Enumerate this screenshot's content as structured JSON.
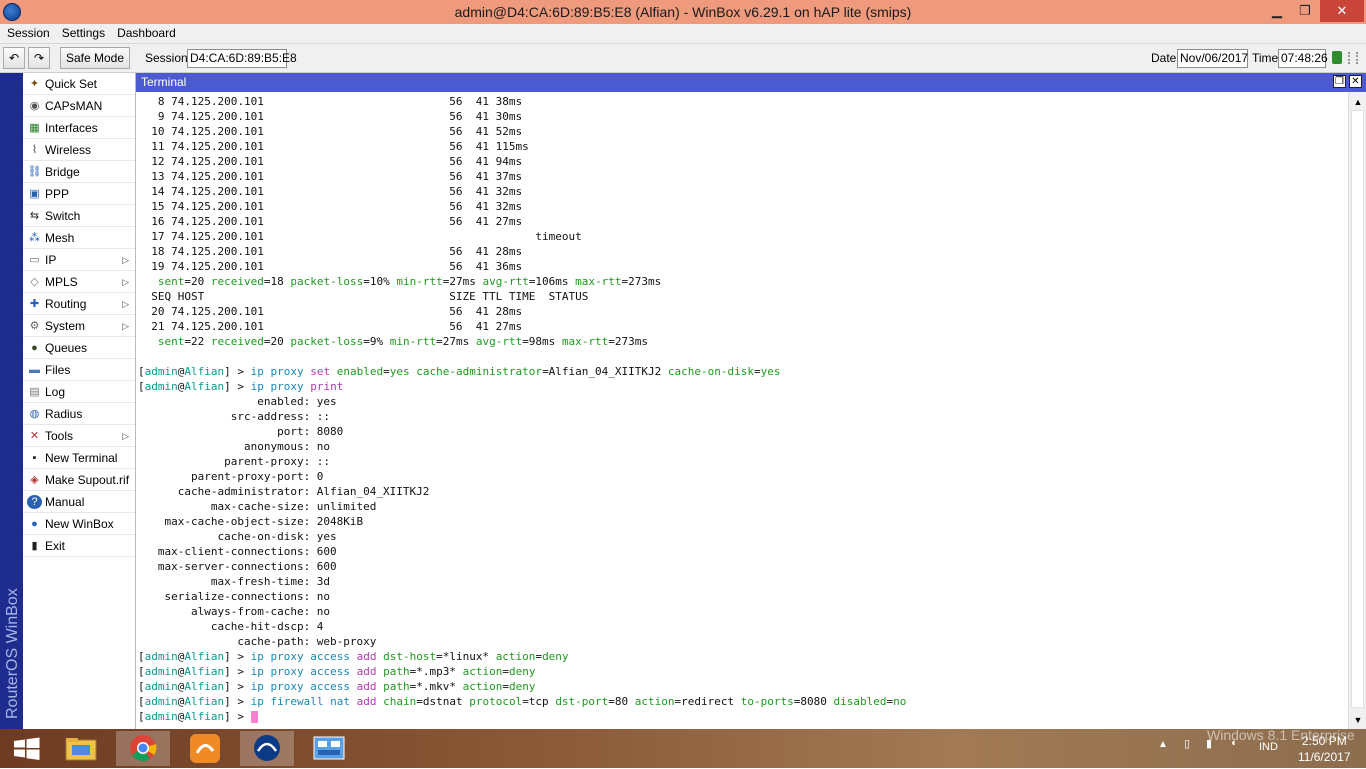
{
  "window": {
    "title": "admin@D4:CA:6D:89:B5:E8 (Alfian) - WinBox v6.29.1 on hAP lite (smips)"
  },
  "menu": [
    "Session",
    "Settings",
    "Dashboard"
  ],
  "toolbar": {
    "safe_mode_label": "Safe Mode",
    "session_label": "Session:",
    "session_value": "D4:CA:6D:89:B5:E8",
    "date_label": "Date:",
    "date_value": "Nov/06/2017",
    "time_label": "Time:",
    "time_value": "07:48:26"
  },
  "brand": "RouterOS WinBox",
  "sidebar": [
    {
      "label": "Quick Set",
      "icon": "quickset-icon",
      "glyph": "✦",
      "color": "#7a4a1a"
    },
    {
      "label": "CAPsMAN",
      "icon": "capsman-icon",
      "glyph": "◉",
      "color": "#555"
    },
    {
      "label": "Interfaces",
      "icon": "interfaces-icon",
      "glyph": "▦",
      "color": "#1f7a1f"
    },
    {
      "label": "Wireless",
      "icon": "wireless-icon",
      "glyph": "⌇",
      "color": "#444"
    },
    {
      "label": "Bridge",
      "icon": "bridge-icon",
      "glyph": "⛓",
      "color": "#2a62b3"
    },
    {
      "label": "PPP",
      "icon": "ppp-icon",
      "glyph": "▣",
      "color": "#2a62b3"
    },
    {
      "label": "Switch",
      "icon": "switch-icon",
      "glyph": "⇆",
      "color": "#333"
    },
    {
      "label": "Mesh",
      "icon": "mesh-icon",
      "glyph": "⁂",
      "color": "#2a62b3"
    },
    {
      "label": "IP",
      "icon": "ip-icon",
      "glyph": "▭",
      "color": "#666",
      "arrow": true
    },
    {
      "label": "MPLS",
      "icon": "mpls-icon",
      "glyph": "◇",
      "color": "#777",
      "arrow": true
    },
    {
      "label": "Routing",
      "icon": "routing-icon",
      "glyph": "✚",
      "color": "#2a62b3",
      "arrow": true
    },
    {
      "label": "System",
      "icon": "system-icon",
      "glyph": "⚙",
      "color": "#666",
      "arrow": true
    },
    {
      "label": "Queues",
      "icon": "queues-icon",
      "glyph": "●",
      "color": "#3a4a2a"
    },
    {
      "label": "Files",
      "icon": "files-icon",
      "glyph": "▬",
      "color": "#4a7ab8"
    },
    {
      "label": "Log",
      "icon": "log-icon",
      "glyph": "▤",
      "color": "#777"
    },
    {
      "label": "Radius",
      "icon": "radius-icon",
      "glyph": "◍",
      "color": "#2a62b3"
    },
    {
      "label": "Tools",
      "icon": "tools-icon",
      "glyph": "✕",
      "color": "#a33",
      "arrow": true
    },
    {
      "label": "New Terminal",
      "icon": "terminal-icon",
      "glyph": "▪",
      "color": "#222"
    },
    {
      "label": "Make Supout.rif",
      "icon": "supout-icon",
      "glyph": "◈",
      "color": "#a33"
    },
    {
      "label": "Manual",
      "icon": "manual-icon",
      "glyph": "?",
      "color": "#fff",
      "bg": "#2a62b3"
    },
    {
      "label": "New WinBox",
      "icon": "winbox-icon",
      "glyph": "●",
      "color": "#2a62b3"
    },
    {
      "label": "Exit",
      "icon": "exit-icon",
      "glyph": "▮",
      "color": "#222"
    }
  ],
  "terminal_title": "Terminal",
  "terminal_lines": [
    [
      [
        "   8 74.125.200.101                            56  41 38ms",
        "k"
      ]
    ],
    [
      [
        "   9 74.125.200.101                            56  41 30ms",
        "k"
      ]
    ],
    [
      [
        "  10 74.125.200.101                            56  41 52ms",
        "k"
      ]
    ],
    [
      [
        "  11 74.125.200.101                            56  41 115ms",
        "k"
      ]
    ],
    [
      [
        "  12 74.125.200.101                            56  41 94ms",
        "k"
      ]
    ],
    [
      [
        "  13 74.125.200.101                            56  41 37ms",
        "k"
      ]
    ],
    [
      [
        "  14 74.125.200.101                            56  41 32ms",
        "k"
      ]
    ],
    [
      [
        "  15 74.125.200.101                            56  41 32ms",
        "k"
      ]
    ],
    [
      [
        "  16 74.125.200.101                            56  41 27ms",
        "k"
      ]
    ],
    [
      [
        "  17 74.125.200.101                                         timeout",
        "k"
      ]
    ],
    [
      [
        "  18 74.125.200.101                            56  41 28ms",
        "k"
      ]
    ],
    [
      [
        "  19 74.125.200.101                            56  41 36ms",
        "k"
      ]
    ],
    [
      [
        "   ",
        "k"
      ],
      [
        "sent",
        "gr"
      ],
      [
        "=20 ",
        "k"
      ],
      [
        "received",
        "gr"
      ],
      [
        "=18 ",
        "k"
      ],
      [
        "packet-loss",
        "gr"
      ],
      [
        "=10% ",
        "k"
      ],
      [
        "min-rtt",
        "gr"
      ],
      [
        "=27ms ",
        "k"
      ],
      [
        "avg-rtt",
        "gr"
      ],
      [
        "=106ms ",
        "k"
      ],
      [
        "max-rtt",
        "gr"
      ],
      [
        "=273ms",
        "k"
      ]
    ],
    [
      [
        "  SEQ HOST                                     SIZE TTL TIME  STATUS",
        "k"
      ]
    ],
    [
      [
        "  20 74.125.200.101                            56  41 28ms",
        "k"
      ]
    ],
    [
      [
        "  21 74.125.200.101                            56  41 27ms",
        "k"
      ]
    ],
    [
      [
        "   ",
        "k"
      ],
      [
        "sent",
        "gr"
      ],
      [
        "=22 ",
        "k"
      ],
      [
        "received",
        "gr"
      ],
      [
        "=20 ",
        "k"
      ],
      [
        "packet-loss",
        "gr"
      ],
      [
        "=9% ",
        "k"
      ],
      [
        "min-rtt",
        "gr"
      ],
      [
        "=27ms ",
        "k"
      ],
      [
        "avg-rtt",
        "gr"
      ],
      [
        "=98ms ",
        "k"
      ],
      [
        "max-rtt",
        "gr"
      ],
      [
        "=273ms",
        "k"
      ]
    ],
    [
      [
        "",
        "k"
      ]
    ],
    [
      [
        "[",
        "k"
      ],
      [
        "admin",
        "g"
      ],
      [
        "@",
        "k"
      ],
      [
        "Alfian",
        "g"
      ],
      [
        "] > ",
        "k"
      ],
      [
        "ip proxy ",
        "c"
      ],
      [
        "set ",
        "p"
      ],
      [
        "enabled",
        "gr"
      ],
      [
        "=",
        "k"
      ],
      [
        "yes ",
        "gr"
      ],
      [
        "cache-administrator",
        "gr"
      ],
      [
        "=Alfian_04_XIITKJ2 ",
        "k"
      ],
      [
        "cache-on-disk",
        "gr"
      ],
      [
        "=",
        "k"
      ],
      [
        "yes",
        "gr"
      ]
    ],
    [
      [
        "[",
        "k"
      ],
      [
        "admin",
        "g"
      ],
      [
        "@",
        "k"
      ],
      [
        "Alfian",
        "g"
      ],
      [
        "] > ",
        "k"
      ],
      [
        "ip proxy ",
        "c"
      ],
      [
        "print",
        "p"
      ]
    ],
    [
      [
        "                  enabled: yes",
        "k"
      ]
    ],
    [
      [
        "              src-address: ::",
        "k"
      ]
    ],
    [
      [
        "                     port: 8080",
        "k"
      ]
    ],
    [
      [
        "                anonymous: no",
        "k"
      ]
    ],
    [
      [
        "             parent-proxy: ::",
        "k"
      ]
    ],
    [
      [
        "        parent-proxy-port: 0",
        "k"
      ]
    ],
    [
      [
        "      cache-administrator: Alfian_04_XIITKJ2",
        "k"
      ]
    ],
    [
      [
        "           max-cache-size: unlimited",
        "k"
      ]
    ],
    [
      [
        "    max-cache-object-size: 2048KiB",
        "k"
      ]
    ],
    [
      [
        "            cache-on-disk: yes",
        "k"
      ]
    ],
    [
      [
        "   max-client-connections: 600",
        "k"
      ]
    ],
    [
      [
        "   max-server-connections: 600",
        "k"
      ]
    ],
    [
      [
        "           max-fresh-time: 3d",
        "k"
      ]
    ],
    [
      [
        "    serialize-connections: no",
        "k"
      ]
    ],
    [
      [
        "        always-from-cache: no",
        "k"
      ]
    ],
    [
      [
        "           cache-hit-dscp: 4",
        "k"
      ]
    ],
    [
      [
        "               cache-path: web-proxy",
        "k"
      ]
    ],
    [
      [
        "[",
        "k"
      ],
      [
        "admin",
        "g"
      ],
      [
        "@",
        "k"
      ],
      [
        "Alfian",
        "g"
      ],
      [
        "] > ",
        "k"
      ],
      [
        "ip proxy access ",
        "c"
      ],
      [
        "add ",
        "p"
      ],
      [
        "dst-host",
        "gr"
      ],
      [
        "=*linux* ",
        "k"
      ],
      [
        "action",
        "gr"
      ],
      [
        "=",
        "k"
      ],
      [
        "deny",
        "gr"
      ]
    ],
    [
      [
        "[",
        "k"
      ],
      [
        "admin",
        "g"
      ],
      [
        "@",
        "k"
      ],
      [
        "Alfian",
        "g"
      ],
      [
        "] > ",
        "k"
      ],
      [
        "ip proxy access ",
        "c"
      ],
      [
        "add ",
        "p"
      ],
      [
        "path",
        "gr"
      ],
      [
        "=*.mp3* ",
        "k"
      ],
      [
        "action",
        "gr"
      ],
      [
        "=",
        "k"
      ],
      [
        "deny",
        "gr"
      ]
    ],
    [
      [
        "[",
        "k"
      ],
      [
        "admin",
        "g"
      ],
      [
        "@",
        "k"
      ],
      [
        "Alfian",
        "g"
      ],
      [
        "] > ",
        "k"
      ],
      [
        "ip proxy access ",
        "c"
      ],
      [
        "add ",
        "p"
      ],
      [
        "path",
        "gr"
      ],
      [
        "=*.mkv* ",
        "k"
      ],
      [
        "action",
        "gr"
      ],
      [
        "=",
        "k"
      ],
      [
        "deny",
        "gr"
      ]
    ],
    [
      [
        "[",
        "k"
      ],
      [
        "admin",
        "g"
      ],
      [
        "@",
        "k"
      ],
      [
        "Alfian",
        "g"
      ],
      [
        "] > ",
        "k"
      ],
      [
        "ip firewall nat ",
        "c"
      ],
      [
        "add ",
        "p"
      ],
      [
        "chain",
        "gr"
      ],
      [
        "=dstnat ",
        "k"
      ],
      [
        "protocol",
        "gr"
      ],
      [
        "=tcp ",
        "k"
      ],
      [
        "dst-port",
        "gr"
      ],
      [
        "=80 ",
        "k"
      ],
      [
        "action",
        "gr"
      ],
      [
        "=redirect ",
        "k"
      ],
      [
        "to-ports",
        "gr"
      ],
      [
        "=8080 ",
        "k"
      ],
      [
        "disabled",
        "gr"
      ],
      [
        "=",
        "k"
      ],
      [
        "no",
        "gr"
      ]
    ],
    [
      [
        "[",
        "k"
      ],
      [
        "admin",
        "g"
      ],
      [
        "@",
        "k"
      ],
      [
        "Alfian",
        "g"
      ],
      [
        "] > ",
        "k"
      ],
      [
        "",
        "cursor"
      ]
    ]
  ],
  "taskbar": {
    "apps": [
      "windows-start-icon",
      "file-explorer-icon",
      "chrome-icon",
      "uc-browser-icon",
      "winbox-app-icon",
      "control-panel-icon"
    ],
    "lang": "IND",
    "clock_time": "2:50 PM",
    "clock_date": "11/6/2017",
    "watermark": "Windows 8.1 Enterprise"
  }
}
